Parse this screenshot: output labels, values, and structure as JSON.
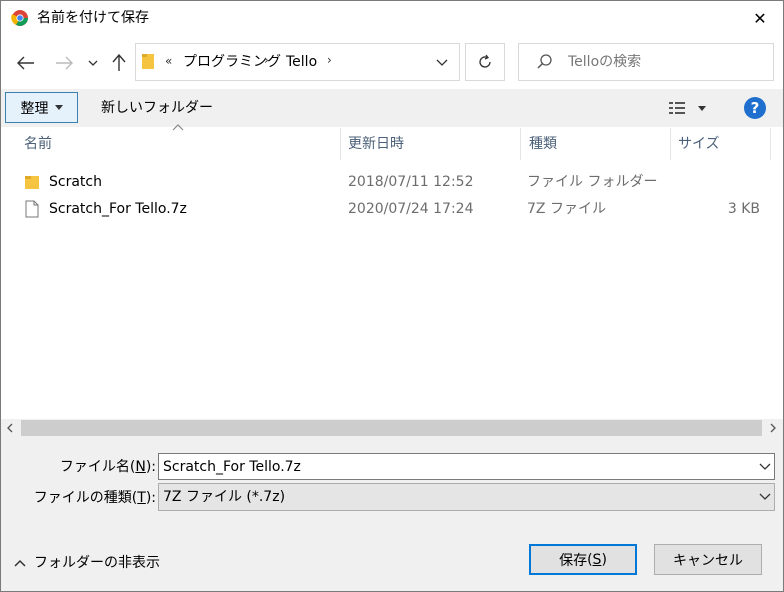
{
  "window": {
    "title": "名前を付けて保存",
    "close_glyph": "✕"
  },
  "address_bar": {
    "overflow_glyph": "«",
    "crumbs": [
      "プログラミング",
      "Tello"
    ],
    "separator_glyph": "›"
  },
  "search": {
    "placeholder": "Telloの検索"
  },
  "toolbar": {
    "organize_label": "整理",
    "new_folder_label": "新しいフォルダー",
    "help_label": "?"
  },
  "columns": {
    "name": "名前",
    "date": "更新日時",
    "type": "種類",
    "size": "サイズ"
  },
  "files": [
    {
      "icon": "folder-icon",
      "name": "Scratch",
      "date": "2018/07/11 12:52",
      "type": "ファイル フォルダー",
      "size": ""
    },
    {
      "icon": "file-icon",
      "name": "Scratch_For Tello.7z",
      "date": "2020/07/24 17:24",
      "type": "7Z ファイル",
      "size": "3 KB"
    }
  ],
  "form": {
    "filename_label": "ファイル名",
    "filename_key": "N",
    "filename_value": "Scratch_For Tello.7z",
    "filetype_label": "ファイルの種類",
    "filetype_key": "T",
    "filetype_value": "7Z ファイル (*.7z)"
  },
  "footer": {
    "hide_folders_label": "フォルダーの非表示",
    "save_label": "保存",
    "save_key": "S",
    "cancel_label": "キャンセル"
  },
  "colors": {
    "accent": "#0078d7",
    "folder": "#f5c542",
    "help": "#1f6fce",
    "header_text": "#4c607a"
  }
}
